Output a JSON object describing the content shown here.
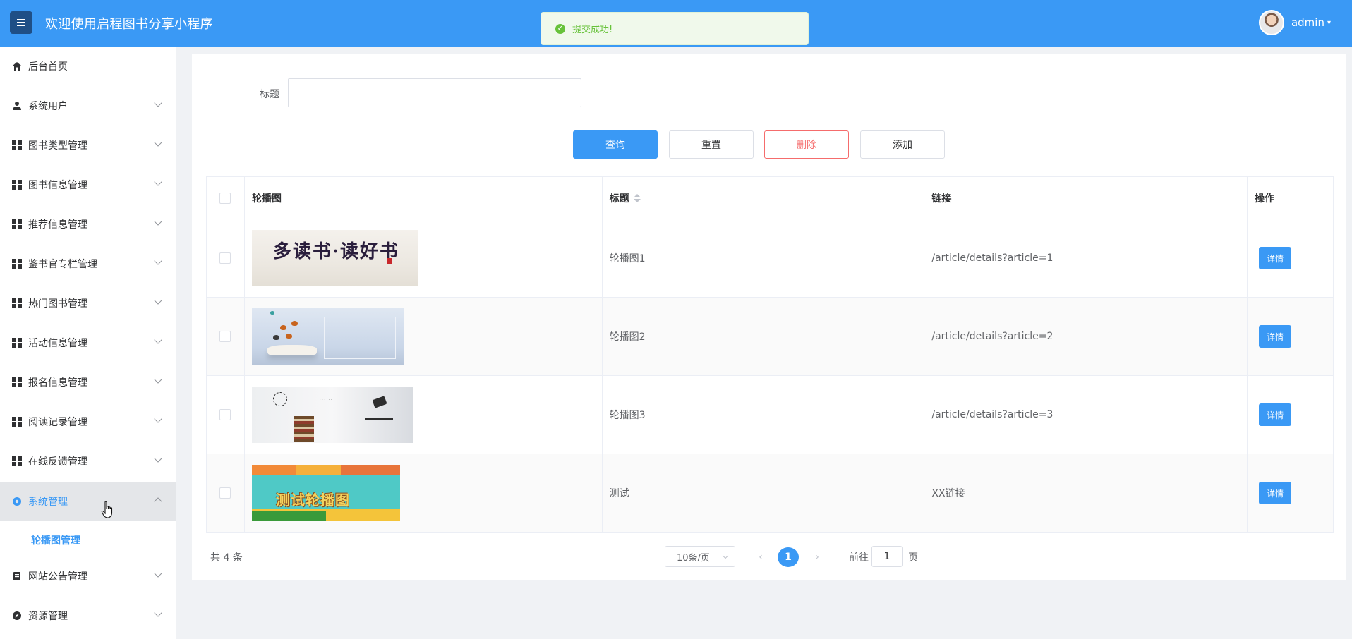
{
  "header": {
    "title": "欢迎使用启程图书分享小程序",
    "user_name": "admin"
  },
  "toast": {
    "message": "提交成功!"
  },
  "sidebar": {
    "items": [
      {
        "label": "后台首页",
        "icon": "home-icon"
      },
      {
        "label": "系统用户",
        "icon": "user-icon"
      },
      {
        "label": "图书类型管理",
        "icon": "grid-icon"
      },
      {
        "label": "图书信息管理",
        "icon": "grid-icon"
      },
      {
        "label": "推荐信息管理",
        "icon": "grid-icon"
      },
      {
        "label": "鉴书官专栏管理",
        "icon": "grid-icon"
      },
      {
        "label": "热门图书管理",
        "icon": "grid-icon"
      },
      {
        "label": "活动信息管理",
        "icon": "grid-icon"
      },
      {
        "label": "报名信息管理",
        "icon": "grid-icon"
      },
      {
        "label": "阅读记录管理",
        "icon": "grid-icon"
      },
      {
        "label": "在线反馈管理",
        "icon": "grid-icon"
      },
      {
        "label": "系统管理",
        "icon": "gear-icon"
      },
      {
        "label": "网站公告管理",
        "icon": "document-icon"
      },
      {
        "label": "资源管理",
        "icon": "compass-icon"
      }
    ],
    "sub_item": "轮播图管理"
  },
  "search": {
    "label": "标题",
    "value": ""
  },
  "buttons": {
    "query": "查询",
    "reset": "重置",
    "delete": "删除",
    "add": "添加"
  },
  "table": {
    "columns": [
      "轮播图",
      "标题",
      "链接",
      "操作"
    ],
    "rows": [
      {
        "title": "轮播图1",
        "link": "/article/details?article=1",
        "action": "详情",
        "image_text": "多读书·读好书"
      },
      {
        "title": "轮播图2",
        "link": "/article/details?article=2",
        "action": "详情"
      },
      {
        "title": "轮播图3",
        "link": "/article/details?article=3",
        "action": "详情"
      },
      {
        "title": "测试",
        "link": "XX链接",
        "action": "详情",
        "image_text": "测试轮播图"
      }
    ]
  },
  "pagination": {
    "total": "共 4 条",
    "page_size": "10条/页",
    "current_page": "1",
    "goto_label": "前往",
    "goto_value": "1",
    "goto_unit": "页"
  },
  "colors": {
    "primary": "#3a99f5",
    "danger": "#f56c6c",
    "success": "#67c23a"
  }
}
